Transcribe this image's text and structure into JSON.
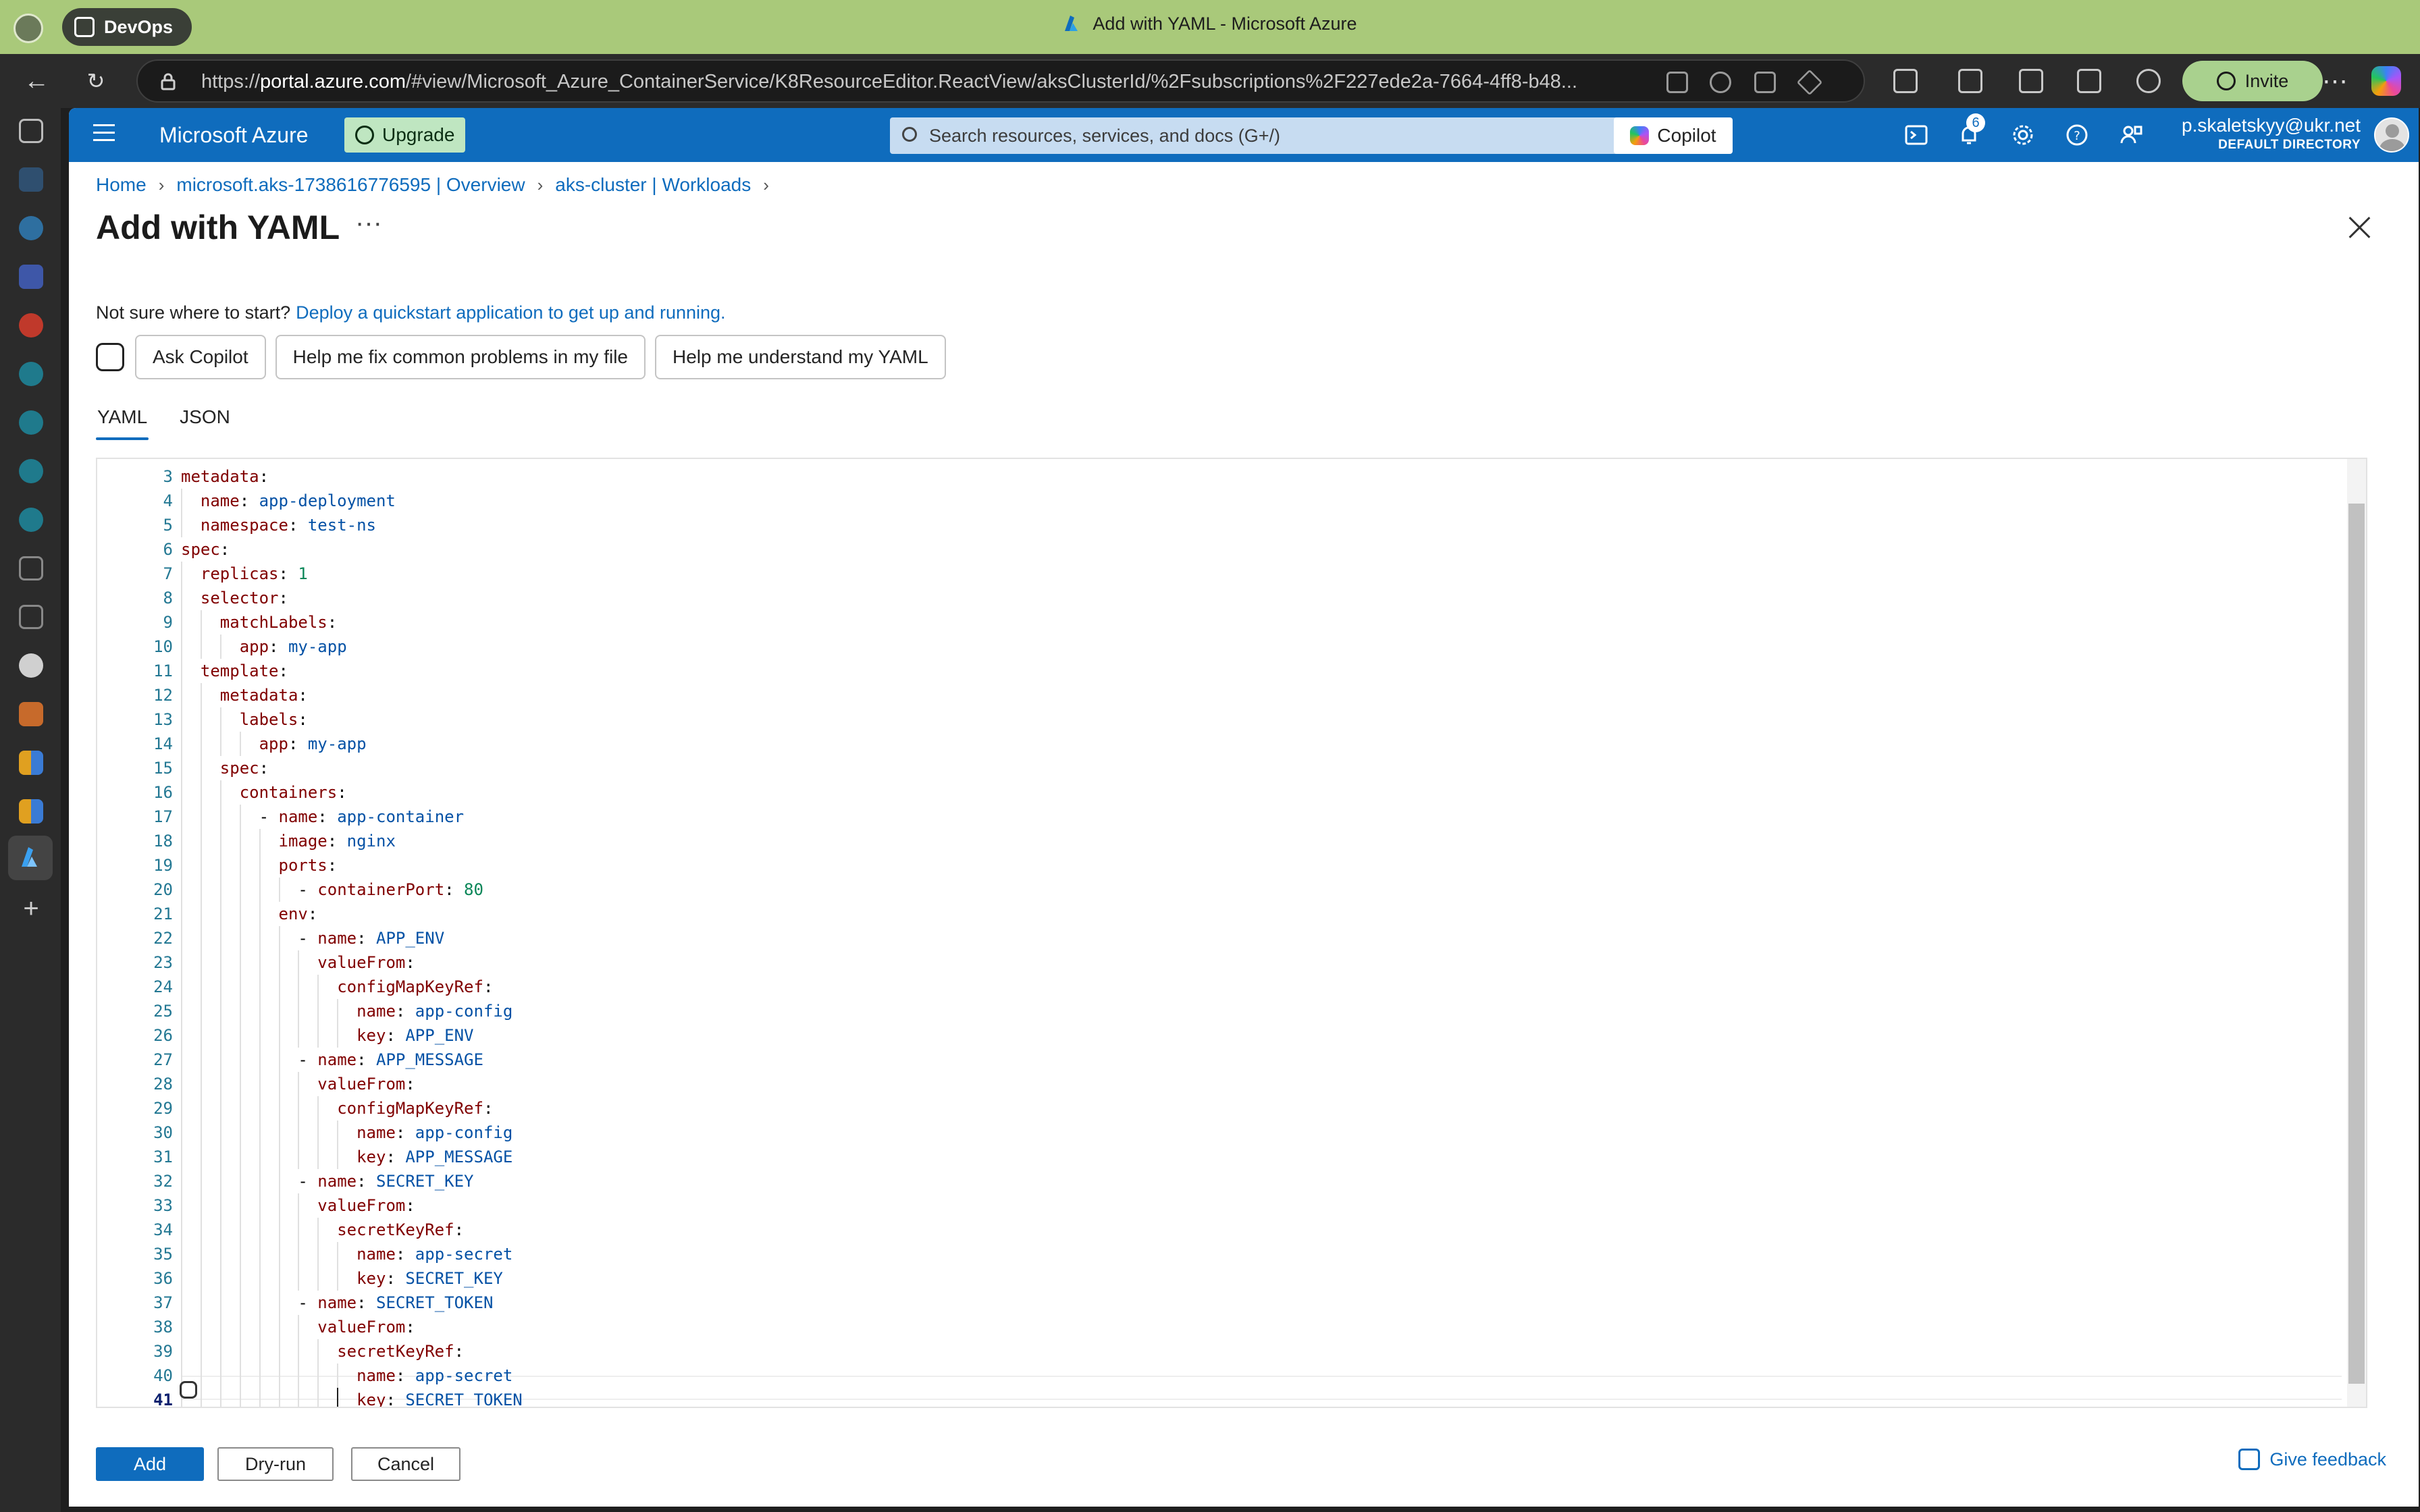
{
  "browser": {
    "workspace_label": "DevOps",
    "window_title": "Add with YAML - Microsoft Azure",
    "url_prefix": "https://",
    "url_host": "portal.azure.com",
    "url_rest": "/#view/Microsoft_Azure_ContainerService/K8ResourceEditor.ReactView/aksClusterId/%2Fsubscriptions%2F227ede2a-7664-4ff8-b48...",
    "invite_label": "Invite"
  },
  "header": {
    "brand": "Microsoft Azure",
    "upgrade_label": "Upgrade",
    "search_placeholder": "Search resources, services, and docs (G+/)",
    "copilot_label": "Copilot",
    "notification_count": "6",
    "account_name": "p.skaletskyy@ukr.net",
    "account_directory": "DEFAULT DIRECTORY"
  },
  "breadcrumb": [
    "Home",
    "microsoft.aks-1738616776595 | Overview",
    "aks-cluster | Workloads"
  ],
  "page": {
    "title": "Add with YAML",
    "more": "···",
    "intro_text": "Not sure where to start?",
    "intro_link": "Deploy a quickstart application to get up and running."
  },
  "chips": [
    "Ask Copilot",
    "Help me fix common problems in my file",
    "Help me understand my YAML"
  ],
  "tabs": [
    "YAML",
    "JSON"
  ],
  "editor": {
    "current_line": 41,
    "lines": [
      {
        "n": 3,
        "indent": 0,
        "dash": false,
        "key": "metadata",
        "value": ""
      },
      {
        "n": 4,
        "indent": 1,
        "dash": false,
        "key": "name",
        "value": "app-deployment"
      },
      {
        "n": 5,
        "indent": 1,
        "dash": false,
        "key": "namespace",
        "value": "test-ns"
      },
      {
        "n": 6,
        "indent": 0,
        "dash": false,
        "key": "spec",
        "value": ""
      },
      {
        "n": 7,
        "indent": 1,
        "dash": false,
        "key": "replicas",
        "value": "1",
        "numeric": true
      },
      {
        "n": 8,
        "indent": 1,
        "dash": false,
        "key": "selector",
        "value": ""
      },
      {
        "n": 9,
        "indent": 2,
        "dash": false,
        "key": "matchLabels",
        "value": ""
      },
      {
        "n": 10,
        "indent": 3,
        "dash": false,
        "key": "app",
        "value": "my-app"
      },
      {
        "n": 11,
        "indent": 1,
        "dash": false,
        "key": "template",
        "value": ""
      },
      {
        "n": 12,
        "indent": 2,
        "dash": false,
        "key": "metadata",
        "value": ""
      },
      {
        "n": 13,
        "indent": 3,
        "dash": false,
        "key": "labels",
        "value": ""
      },
      {
        "n": 14,
        "indent": 4,
        "dash": false,
        "key": "app",
        "value": "my-app"
      },
      {
        "n": 15,
        "indent": 2,
        "dash": false,
        "key": "spec",
        "value": ""
      },
      {
        "n": 16,
        "indent": 3,
        "dash": false,
        "key": "containers",
        "value": ""
      },
      {
        "n": 17,
        "indent": 4,
        "dash": true,
        "key": "name",
        "value": "app-container"
      },
      {
        "n": 18,
        "indent": 5,
        "dash": false,
        "key": "image",
        "value": "nginx"
      },
      {
        "n": 19,
        "indent": 5,
        "dash": false,
        "key": "ports",
        "value": ""
      },
      {
        "n": 20,
        "indent": 6,
        "dash": true,
        "key": "containerPort",
        "value": "80",
        "numeric": true
      },
      {
        "n": 21,
        "indent": 5,
        "dash": false,
        "key": "env",
        "value": ""
      },
      {
        "n": 22,
        "indent": 6,
        "dash": true,
        "key": "name",
        "value": "APP_ENV"
      },
      {
        "n": 23,
        "indent": 7,
        "dash": false,
        "key": "valueFrom",
        "value": ""
      },
      {
        "n": 24,
        "indent": 8,
        "dash": false,
        "key": "configMapKeyRef",
        "value": ""
      },
      {
        "n": 25,
        "indent": 9,
        "dash": false,
        "key": "name",
        "value": "app-config"
      },
      {
        "n": 26,
        "indent": 9,
        "dash": false,
        "key": "key",
        "value": "APP_ENV"
      },
      {
        "n": 27,
        "indent": 6,
        "dash": true,
        "key": "name",
        "value": "APP_MESSAGE"
      },
      {
        "n": 28,
        "indent": 7,
        "dash": false,
        "key": "valueFrom",
        "value": ""
      },
      {
        "n": 29,
        "indent": 8,
        "dash": false,
        "key": "configMapKeyRef",
        "value": ""
      },
      {
        "n": 30,
        "indent": 9,
        "dash": false,
        "key": "name",
        "value": "app-config"
      },
      {
        "n": 31,
        "indent": 9,
        "dash": false,
        "key": "key",
        "value": "APP_MESSAGE"
      },
      {
        "n": 32,
        "indent": 6,
        "dash": true,
        "key": "name",
        "value": "SECRET_KEY"
      },
      {
        "n": 33,
        "indent": 7,
        "dash": false,
        "key": "valueFrom",
        "value": ""
      },
      {
        "n": 34,
        "indent": 8,
        "dash": false,
        "key": "secretKeyRef",
        "value": ""
      },
      {
        "n": 35,
        "indent": 9,
        "dash": false,
        "key": "name",
        "value": "app-secret"
      },
      {
        "n": 36,
        "indent": 9,
        "dash": false,
        "key": "key",
        "value": "SECRET_KEY"
      },
      {
        "n": 37,
        "indent": 6,
        "dash": true,
        "key": "name",
        "value": "SECRET_TOKEN"
      },
      {
        "n": 38,
        "indent": 7,
        "dash": false,
        "key": "valueFrom",
        "value": ""
      },
      {
        "n": 39,
        "indent": 8,
        "dash": false,
        "key": "secretKeyRef",
        "value": ""
      },
      {
        "n": 40,
        "indent": 9,
        "dash": false,
        "key": "name",
        "value": "app-secret"
      },
      {
        "n": 41,
        "indent": 9,
        "dash": false,
        "key": "key",
        "value": "SECRET_TOKEN"
      }
    ]
  },
  "footer": {
    "add_label": "Add",
    "dryrun_label": "Dry-run",
    "cancel_label": "Cancel",
    "feedback_label": "Give feedback"
  },
  "colors": {
    "accent": "#0f6cbd",
    "title_bar": "#a9c97a",
    "yaml_key": "#800000",
    "yaml_value": "#0451a5",
    "yaml_number": "#098658"
  }
}
